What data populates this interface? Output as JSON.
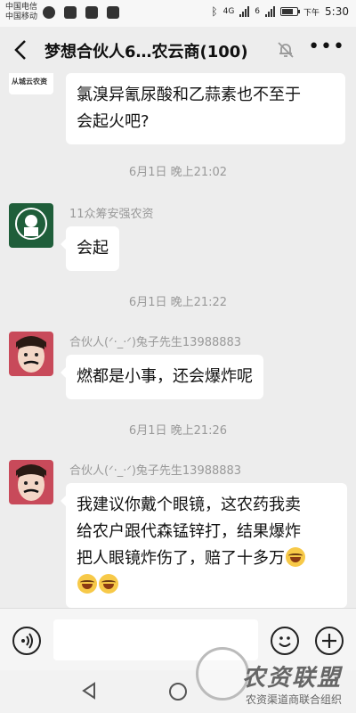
{
  "status_bar": {
    "carrier1": "中国电信",
    "carrier2": "中国移动",
    "time_prefix": "下午",
    "time": "5:30",
    "net1": "4G",
    "net2": "6"
  },
  "header": {
    "back_icon": "chevron-left-icon",
    "title": "梦想合伙人6…农云商(100)",
    "mute_icon": "bell-muted-icon",
    "more_icon": "ellipsis-icon"
  },
  "messages": [
    {
      "type": "bubble",
      "text_lines": [
        "氯溴异氰尿酸和乙蒜素也不至于",
        "会起火吧?"
      ]
    },
    {
      "type": "time",
      "text": "6月1日 晚上21:02"
    },
    {
      "type": "bubble",
      "sender": "11众筹安强农资",
      "text": "会起"
    },
    {
      "type": "time",
      "text": "6月1日 晚上21:22"
    },
    {
      "type": "bubble",
      "sender": "合伙人(ᐟ·_·ᐟ)兔子先生13988883",
      "text": "燃都是小事，还会爆炸呢"
    },
    {
      "type": "time",
      "text": "6月1日 晚上21:26"
    },
    {
      "type": "bubble",
      "sender": "合伙人(ᐟ·_·ᐟ)兔子先生13988883",
      "text_lines": [
        "我建议你戴个眼镜，这农药我卖",
        "给农户跟代森锰锌打，结果爆炸",
        "把人眼镜炸伤了，赔了十多万"
      ]
    }
  ],
  "avatar_partial_text": "从城云农资",
  "input_bar": {
    "voice_icon": "voice-icon",
    "emoji_icon": "emoji-icon",
    "plus_icon": "plus-icon"
  },
  "nav": {
    "back_icon": "triangle-back-icon",
    "home_icon": "circle-home-icon"
  },
  "watermark": {
    "title": "农资联盟",
    "subtitle": "农资渠道商联合组织"
  }
}
